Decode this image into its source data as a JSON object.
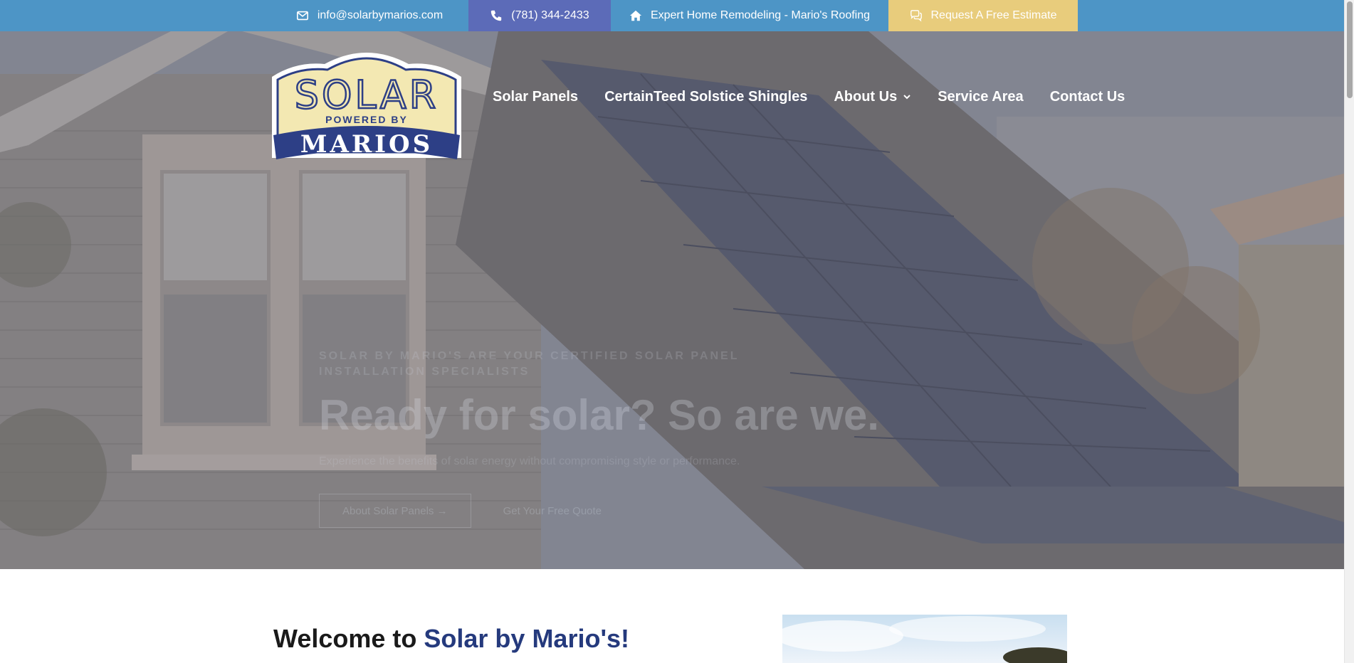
{
  "topbar": {
    "email": "info@solarbymarios.com",
    "phone": "(781) 344-2433",
    "remodeling": "Expert Home Remodeling - Mario's Roofing",
    "estimate": "Request A Free Estimate"
  },
  "logo": {
    "line1": "SOLAR",
    "line2": "POWERED BY",
    "line3": "MARIOS"
  },
  "nav": {
    "items": [
      {
        "label": "Solar Panels"
      },
      {
        "label": "CertainTeed Solstice Shingles"
      },
      {
        "label": "About Us"
      },
      {
        "label": "Service Area"
      },
      {
        "label": "Contact Us"
      }
    ]
  },
  "hero": {
    "eyebrow": "SOLAR BY MARIO'S ARE YOUR CERTIFIED SOLAR PANEL INSTALLATION SPECIALISTS",
    "headline": "Ready for solar? So are we.",
    "sub": "Experience the benefits of solar energy without compromising style or performance.",
    "btn_primary": "About Solar Panels →",
    "btn_secondary": "Get Your Free Quote"
  },
  "welcome": {
    "prefix": "Welcome to ",
    "brand": "Solar by Mario's!"
  },
  "colors": {
    "topbar": "#4d95c6",
    "phone_bg": "#5c6bb8",
    "cta_bg": "#e8cc7c",
    "brand_navy": "#253a7d"
  },
  "icons": {
    "email": "envelope-icon",
    "phone": "phone-icon",
    "home": "home-icon",
    "estimate": "chat-bubbles-icon"
  }
}
